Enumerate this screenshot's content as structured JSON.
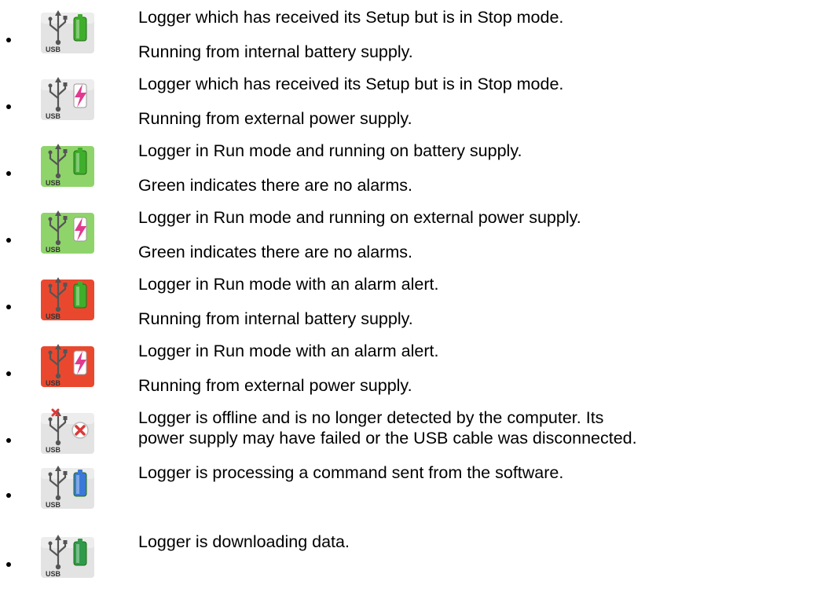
{
  "status_legend": {
    "items": [
      {
        "icon": "usb-battery-stop-icon",
        "bg": "#e3e3e3",
        "power": "battery",
        "power_color": "#3fae2b",
        "lines": [
          "Logger which has received its Setup but is in Stop mode.",
          "Running from internal battery supply."
        ]
      },
      {
        "icon": "usb-external-power-stop-icon",
        "bg": "#e3e3e3",
        "power": "bolt",
        "power_color": "#e03a8f",
        "lines": [
          "Logger which has received its Setup but is in Stop mode.",
          "Running from external power supply."
        ]
      },
      {
        "icon": "usb-battery-run-icon",
        "bg": "#8fd46a",
        "power": "battery",
        "power_color": "#3fae2b",
        "lines": [
          "Logger in Run mode and running on battery supply.",
          "Green indicates there are no alarms."
        ]
      },
      {
        "icon": "usb-external-power-run-icon",
        "bg": "#8fd46a",
        "power": "bolt",
        "power_color": "#e03a8f",
        "lines": [
          "Logger in Run mode and running on external power supply.",
          "Green indicates there are no alarms."
        ]
      },
      {
        "icon": "usb-battery-alarm-icon",
        "bg": "#e9482f",
        "power": "battery",
        "power_color": "#3fae2b",
        "lines": [
          "Logger in Run mode with an alarm alert.",
          "Running from internal battery supply."
        ]
      },
      {
        "icon": "usb-external-power-alarm-icon",
        "bg": "#e9482f",
        "power": "bolt",
        "power_color": "#e03a8f",
        "lines": [
          "Logger in Run mode with an alarm alert.",
          "Running from external power supply."
        ]
      },
      {
        "icon": "usb-offline-icon",
        "bg": "#e3e3e3",
        "power": "offline",
        "power_color": "#d93a3a",
        "lines": [
          "Logger is offline and is no longer detected by the computer. Its",
          "power supply may have failed or the USB cable was disconnected."
        ]
      },
      {
        "icon": "usb-processing-icon",
        "bg": "#e3e3e3",
        "power": "battery",
        "power_color": "#3b78d8",
        "lines": [
          "Logger is processing a command sent from the software."
        ]
      },
      {
        "icon": "usb-downloading-icon",
        "bg": "#e3e3e3",
        "power": "battery",
        "power_color": "#2f9a4a",
        "lines": [
          "Logger is downloading data."
        ]
      }
    ]
  }
}
